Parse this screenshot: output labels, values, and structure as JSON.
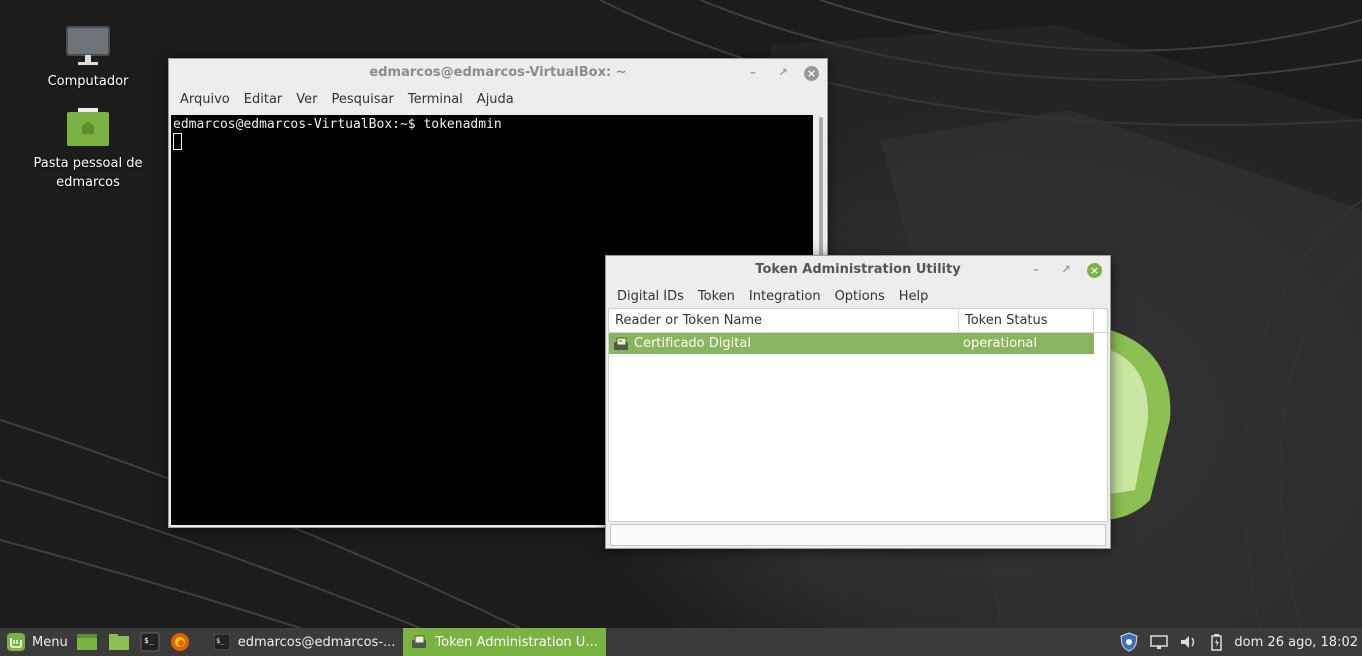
{
  "desktop": {
    "icons": [
      {
        "label": "Computador",
        "icon": "computer-icon"
      },
      {
        "label": "Pasta pessoal de edmarcos",
        "icon": "home-folder-icon"
      }
    ]
  },
  "terminal": {
    "title": "edmarcos@edmarcos-VirtualBox: ~",
    "menu": [
      "Arquivo",
      "Editar",
      "Ver",
      "Pesquisar",
      "Terminal",
      "Ajuda"
    ],
    "line1": "edmarcos@edmarcos-VirtualBox:~$ tokenadmin"
  },
  "token_window": {
    "title": "Token Administration Utility",
    "menu": [
      "Digital IDs",
      "Token",
      "Integration",
      "Options",
      "Help"
    ],
    "columns": [
      "Reader or Token Name",
      "Token Status"
    ],
    "rows": [
      {
        "name": "Certificado Digital",
        "status": "operational"
      }
    ]
  },
  "taskbar": {
    "menu_label": "Menu",
    "tasks": [
      {
        "label": "edmarcos@edmarcos-...",
        "active": false
      },
      {
        "label": "Token Administration U...",
        "active": true
      }
    ],
    "clock": "dom 26 ago, 18:02"
  },
  "colors": {
    "accent": "#7ab342",
    "selection": "#8ab55f",
    "taskbar": "#3b3b3b"
  }
}
